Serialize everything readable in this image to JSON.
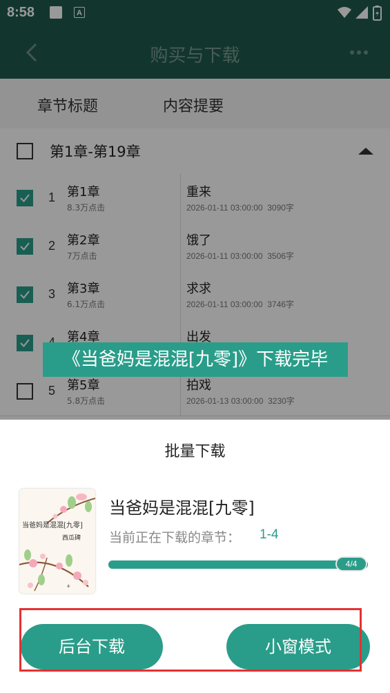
{
  "status_bar": {
    "time": "8:58",
    "a_icon_letter": "A"
  },
  "top_bar": {
    "title": "购买与下载"
  },
  "table_header": {
    "col1": "章节标题",
    "col2": "内容提要"
  },
  "volume": {
    "label": "第1章-第19章"
  },
  "chapters": [
    {
      "num": "1",
      "name": "第1章",
      "clicks": "8.3万点击",
      "title": "重来",
      "date": "2026-01-11 03:00:00",
      "words": "3090字",
      "checked": true
    },
    {
      "num": "2",
      "name": "第2章",
      "clicks": "7万点击",
      "title": "饿了",
      "date": "2026-01-11 03:00:00",
      "words": "3506字",
      "checked": true
    },
    {
      "num": "3",
      "name": "第3章",
      "clicks": "6.1万点击",
      "title": "求求",
      "date": "2026-01-11 03:00:00",
      "words": "3746字",
      "checked": true
    },
    {
      "num": "4",
      "name": "第4章",
      "clicks": "",
      "title": "出发",
      "date": "",
      "words": "",
      "checked": true
    },
    {
      "num": "5",
      "name": "第5章",
      "clicks": "5.8万点击",
      "title": "拍戏",
      "date": "2026-01-13 03:00:00",
      "words": "3230字",
      "checked": false
    }
  ],
  "toast": {
    "text": "《当爸妈是混混[九零]》下载完毕"
  },
  "sheet": {
    "title": "批量下载",
    "book_name": "当爸妈是混混[九零]",
    "downloading_label": "当前正在下载的章节：",
    "downloading_range": "1-4",
    "progress_text": "4/4",
    "progress_fraction": 1.0,
    "cover_title": "当爸妈是混混[九零]",
    "cover_author": "西瓜碑",
    "background_button": "后台下载",
    "mini_window_button": "小窗模式"
  },
  "colors": {
    "teal": "#2a9d8a",
    "dark_green": "#1e5a4e",
    "highlight_red": "#e53030"
  }
}
